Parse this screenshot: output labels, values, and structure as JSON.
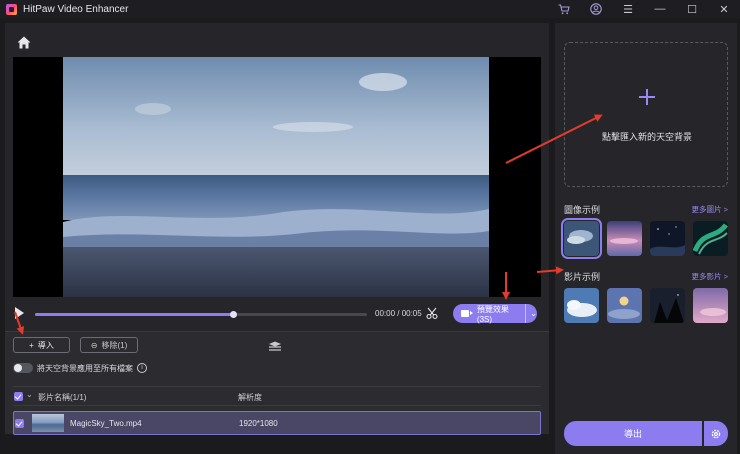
{
  "app": {
    "title": "HitPaw Video Enhancer"
  },
  "titlebar": {
    "icons": [
      "cart-icon",
      "account-icon",
      "menu-icon",
      "minimize-icon",
      "maximize-icon",
      "close-icon"
    ],
    "minimize": "—",
    "maximize": "☐",
    "close": "✕",
    "menu": "☰"
  },
  "player": {
    "time": "00:00 / 00:05",
    "progress": 0.6,
    "preview_label": "預覽效果(3S)",
    "preview_caret": "⌄"
  },
  "toolbar": {
    "import_label": "導入",
    "import_icon": "+",
    "remove_label": "移除(1)",
    "remove_icon": "⊖"
  },
  "apply_all": {
    "label": "將天空背景應用至所有檔案",
    "info": "i",
    "enabled": false
  },
  "file_list": {
    "header_name": "影片名稱(1/1)",
    "header_resolution": "解析度",
    "rows": [
      {
        "name": "MagicSky_Two.mp4",
        "resolution": "1920*1080",
        "checked": true
      }
    ]
  },
  "sidebar": {
    "dropzone_label": "點擊匯入新的天空背景",
    "image_section": {
      "title": "圖像示例",
      "more": "更多圖片 >"
    },
    "video_section": {
      "title": "影片示例",
      "more": "更多影片 >"
    },
    "export_label": "導出"
  },
  "colors": {
    "accent": "#8d7cf0",
    "arrow": "#e53a2c",
    "panel": "#26262a",
    "background": "#1b1b1e"
  }
}
